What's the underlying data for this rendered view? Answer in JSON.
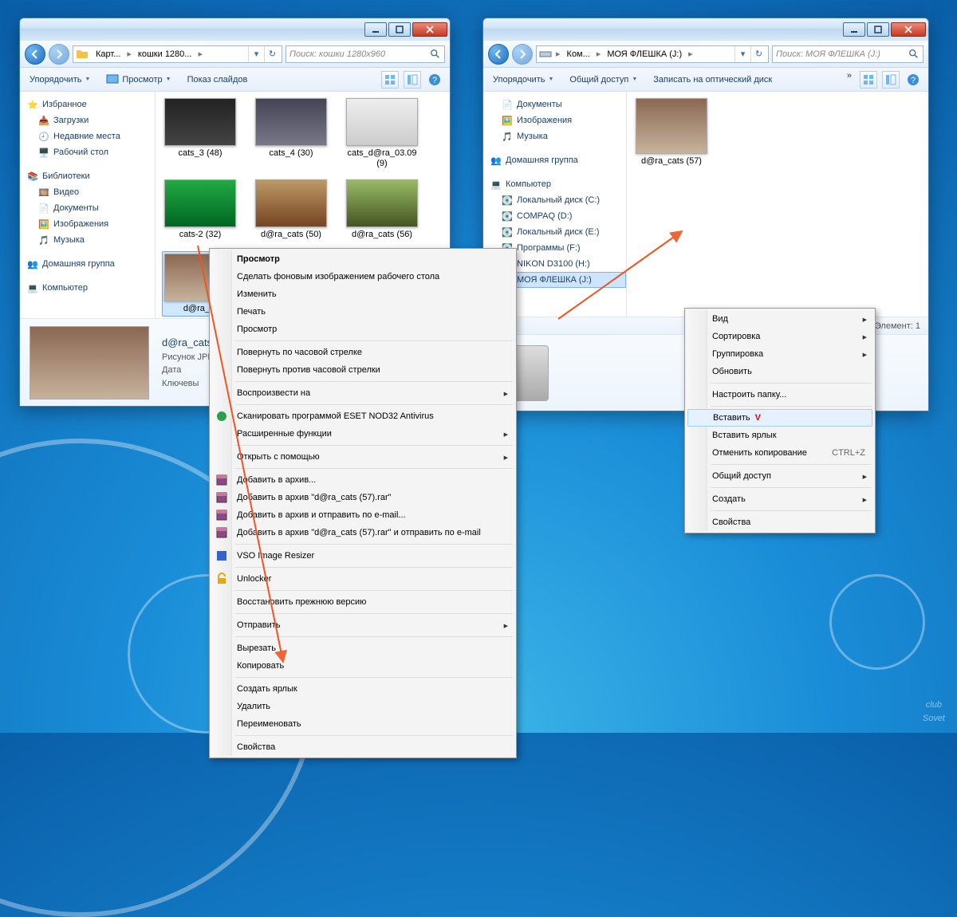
{
  "watermark_top": "club",
  "watermark_bot": "Sovet",
  "win1": {
    "breadcrumb": [
      "Карт...",
      "кошки 1280..."
    ],
    "search_placeholder": "Поиск: кошки 1280x960",
    "toolbar": {
      "organize": "Упорядочить",
      "preview": "Просмотр",
      "slideshow": "Показ слайдов"
    },
    "sidebar": {
      "fav_head": "Избранное",
      "fav": [
        "Загрузки",
        "Недавние места",
        "Рабочий стол"
      ],
      "lib_head": "Библиотеки",
      "lib": [
        "Видео",
        "Документы",
        "Изображения",
        "Музыка"
      ],
      "home": "Домашняя группа",
      "comp": "Компьютер"
    },
    "thumbs": [
      {
        "label": "cats_3 (48)"
      },
      {
        "label": "cats_4 (30)"
      },
      {
        "label": "cats_d@ra_03.09 (9)"
      },
      {
        "label": "cats-2 (32)"
      },
      {
        "label": "d@ra_cats (50)"
      },
      {
        "label": "d@ra_cats (56)"
      },
      {
        "label": "d@ra_..."
      }
    ],
    "detail": {
      "filename": "d@ra_cats",
      "type": "Рисунок JPE",
      "date": "Дата",
      "keys": "Ключевы"
    }
  },
  "win2": {
    "breadcrumb": [
      "Ком...",
      "МОЯ ФЛЕШКА (J:)"
    ],
    "search_placeholder": "Поиск: МОЯ ФЛЕШКА (J:)",
    "toolbar": {
      "organize": "Упорядочить",
      "share": "Общий доступ",
      "burn": "Записать на оптический диск"
    },
    "sidebar": {
      "top": [
        "Документы",
        "Изображения",
        "Музыка"
      ],
      "home": "Домашняя группа",
      "comp": "Компьютер",
      "drives": [
        "Локальный диск (C:)",
        "COMPAQ (D:)",
        "Локальный диск (E:)",
        "Программы  (F:)",
        "NIKON D3100 (H:)",
        "МОЯ ФЛЕШКА (J:)"
      ]
    },
    "thumb": {
      "label": "d@ra_cats (57)"
    },
    "status": "Элемент: 1"
  },
  "menu1": [
    {
      "t": "Просмотр",
      "bold": true
    },
    {
      "t": "Сделать фоновым изображением рабочего стола"
    },
    {
      "t": "Изменить"
    },
    {
      "t": "Печать"
    },
    {
      "t": "Просмотр"
    },
    {
      "sep": true
    },
    {
      "t": "Повернуть по часовой стрелке"
    },
    {
      "t": "Повернуть против часовой стрелки"
    },
    {
      "sep": true
    },
    {
      "t": "Воспроизвести на",
      "sub": true
    },
    {
      "sep": true
    },
    {
      "t": "Сканировать программой ESET NOD32 Antivirus",
      "ic": "eset"
    },
    {
      "t": "Расширенные функции",
      "sub": true
    },
    {
      "sep": true
    },
    {
      "t": "Открыть с помощью",
      "sub": true
    },
    {
      "sep": true
    },
    {
      "t": "Добавить в архив...",
      "ic": "rar"
    },
    {
      "t": "Добавить в архив \"d@ra_cats (57).rar\"",
      "ic": "rar"
    },
    {
      "t": "Добавить в архив и отправить по e-mail...",
      "ic": "rar"
    },
    {
      "t": "Добавить в архив \"d@ra_cats (57).rar\" и отправить по e-mail",
      "ic": "rar"
    },
    {
      "sep": true
    },
    {
      "t": "VSO Image Resizer",
      "ic": "vso"
    },
    {
      "sep": true
    },
    {
      "t": "Unlocker",
      "ic": "unlock"
    },
    {
      "sep": true
    },
    {
      "t": "Восстановить прежнюю версию"
    },
    {
      "sep": true
    },
    {
      "t": "Отправить",
      "sub": true
    },
    {
      "sep": true
    },
    {
      "t": "Вырезать"
    },
    {
      "t": "Копировать"
    },
    {
      "sep": true
    },
    {
      "t": "Создать ярлык"
    },
    {
      "t": "Удалить"
    },
    {
      "t": "Переименовать"
    },
    {
      "sep": true
    },
    {
      "t": "Свойства"
    }
  ],
  "menu2": [
    {
      "t": "Вид",
      "sub": true
    },
    {
      "t": "Сортировка",
      "sub": true
    },
    {
      "t": "Группировка",
      "sub": true
    },
    {
      "t": "Обновить"
    },
    {
      "sep": true
    },
    {
      "t": "Настроить папку..."
    },
    {
      "sep": true
    },
    {
      "t": "Вставить",
      "hi": true,
      "check": true
    },
    {
      "t": "Вставить ярлык"
    },
    {
      "t": "Отменить копирование",
      "shortcut": "CTRL+Z"
    },
    {
      "sep": true
    },
    {
      "t": "Общий доступ",
      "sub": true
    },
    {
      "sep": true
    },
    {
      "t": "Создать",
      "sub": true
    },
    {
      "sep": true
    },
    {
      "t": "Свойства"
    }
  ]
}
